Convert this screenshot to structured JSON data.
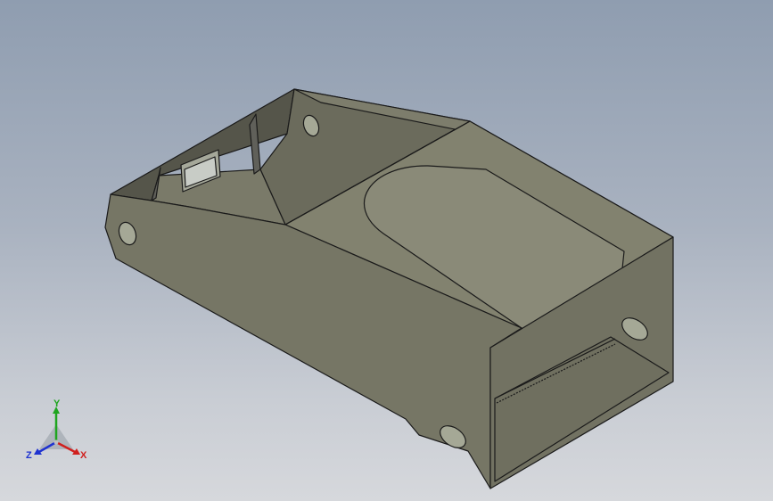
{
  "viewport": {
    "background_top": "#8f9db0",
    "background_bottom": "#d6d8dc"
  },
  "model": {
    "face_color": "#7b7b6a",
    "edge_color": "#1a1a1a"
  },
  "triad": {
    "x_label": "X",
    "y_label": "Y",
    "z_label": "Z",
    "x_color": "#d0201e",
    "y_color": "#1fa51f",
    "z_color": "#1e32d0"
  }
}
